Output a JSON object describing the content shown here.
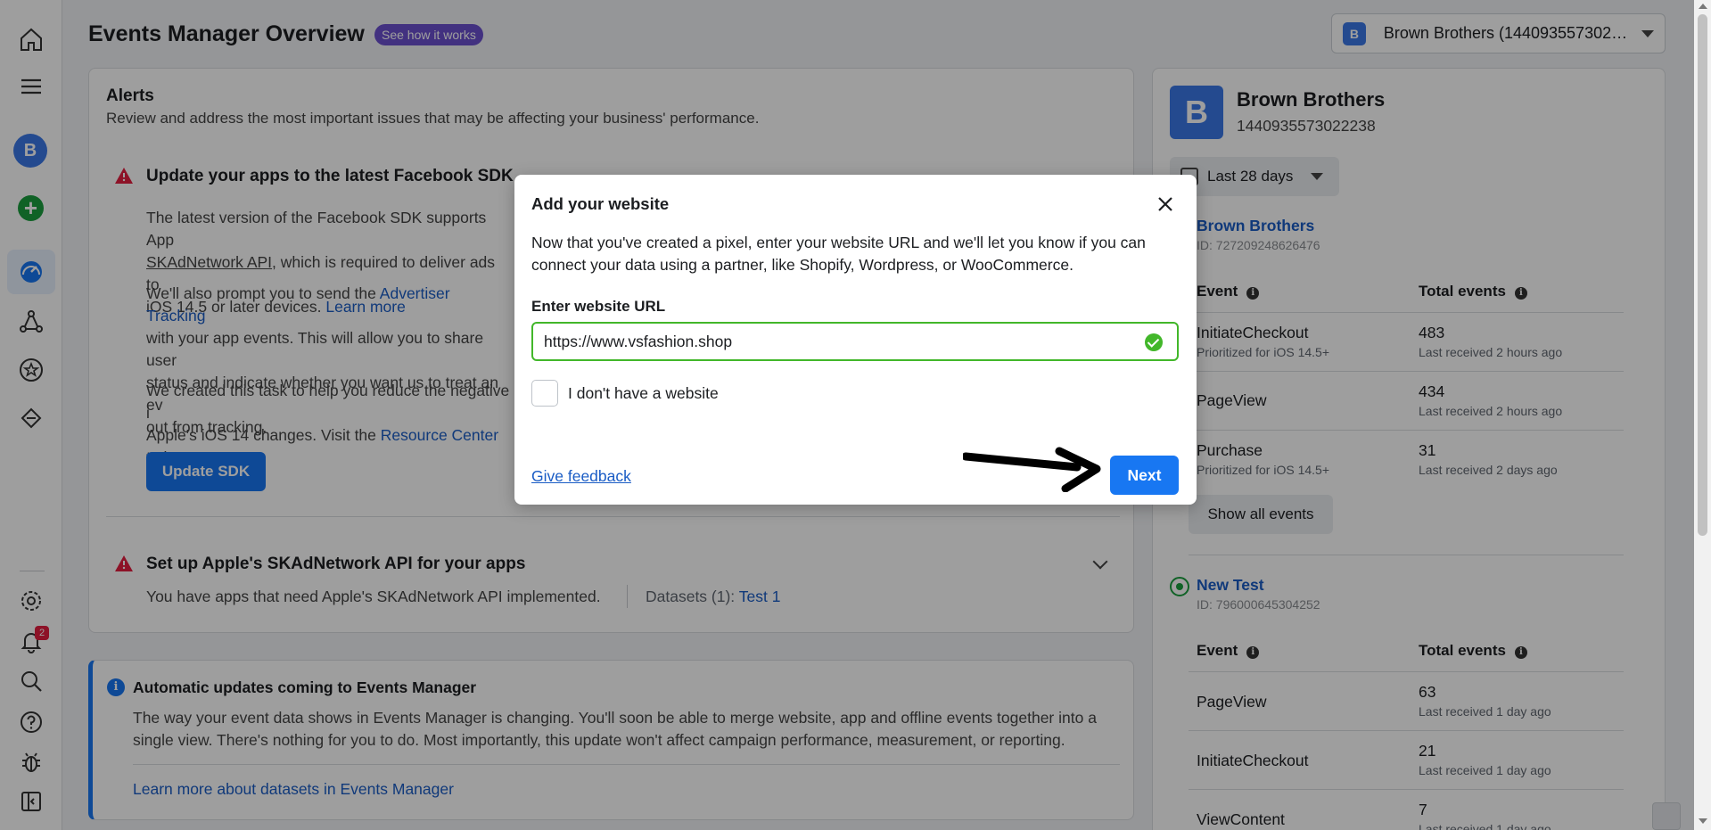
{
  "rail": {
    "avatar_letter": "B",
    "notification_count": "2"
  },
  "header": {
    "title": "Events Manager Overview",
    "help_pill": "See how it works",
    "account_badge": "B",
    "account_name": "Brown Brothers (1440935573022..."
  },
  "alerts": {
    "heading": "Alerts",
    "subheading": "Review and address the most important issues that may be affecting your business' performance.",
    "sdk": {
      "title": "Update your apps to the latest Facebook SDK",
      "p1_a": "The latest version of the Facebook SDK supports App",
      "p1_link": "SKAdNetwork API",
      "p1_b": ", which is required to deliver ads to",
      "p1_c": "iOS 14.5 or later devices.",
      "p1_learn": "Learn more",
      "p2_a": "We'll also prompt you to send the",
      "p2_link": "Advertiser Tracking",
      "p2_b": "with your app events. This will allow you to share user",
      "p2_c": "status and indicate whether you want us to treat an ev",
      "p2_d": "out from tracking.",
      "p3_a": "We created this task to help you reduce the negative i",
      "p3_b": "Apple's iOS 14 changes. Visit the",
      "p3_link": "Resource Center",
      "p3_c": "to l",
      "button": "Update SDK"
    },
    "skad": {
      "title": "Set up Apple's SKAdNetwork API for your apps",
      "desc": "You have apps that need Apple's SKAdNetwork API implemented.",
      "datasets_label": "Datasets (1):",
      "datasets_link": "Test 1"
    }
  },
  "info": {
    "title": "Automatic updates coming to Events Manager",
    "body": "The way your event data shows in Events Manager is changing. You'll soon be able to merge website, app and offline events together into a single view. There's nothing for you to do. Most importantly, this update won't affect campaign performance, measurement, or reporting.",
    "link": "Learn more about datasets in Events Manager"
  },
  "panel": {
    "avatar_letter": "B",
    "business_name": "Brown Brothers",
    "business_id": "1440935573022238",
    "date_range": "Last 28 days",
    "col_event": "Event",
    "col_total": "Total events",
    "show_all": "Show all events",
    "datasets": [
      {
        "name": "Brown Brothers",
        "id": "ID: 727209248626476",
        "events": [
          {
            "name": "InitiateCheckout",
            "sub": "Prioritized for iOS 14.5+",
            "total": "483",
            "received": "Last received 2 hours ago"
          },
          {
            "name": "PageView",
            "sub": "",
            "total": "434",
            "received": "Last received 2 hours ago"
          },
          {
            "name": "Purchase",
            "sub": "Prioritized for iOS 14.5+",
            "total": "31",
            "received": "Last received 2 days ago"
          }
        ]
      },
      {
        "name": "New Test",
        "id": "ID: 796000645304252",
        "events": [
          {
            "name": "PageView",
            "sub": "",
            "total": "63",
            "received": "Last received 1 day ago"
          },
          {
            "name": "InitiateCheckout",
            "sub": "",
            "total": "21",
            "received": "Last received 1 day ago"
          },
          {
            "name": "ViewContent",
            "sub": "",
            "total": "7",
            "received": "Last received 1 day ago"
          }
        ]
      }
    ]
  },
  "modal": {
    "title": "Add your website",
    "description": "Now that you've created a pixel, enter your website URL and we'll let you know if you can connect your data using a partner, like Shopify, Wordpress, or WooCommerce.",
    "url_label": "Enter website URL",
    "url_value": "https://www.vsfashion.shop",
    "no_website_label": "I don't have a website",
    "feedback_link": "Give feedback",
    "next_button": "Next"
  }
}
